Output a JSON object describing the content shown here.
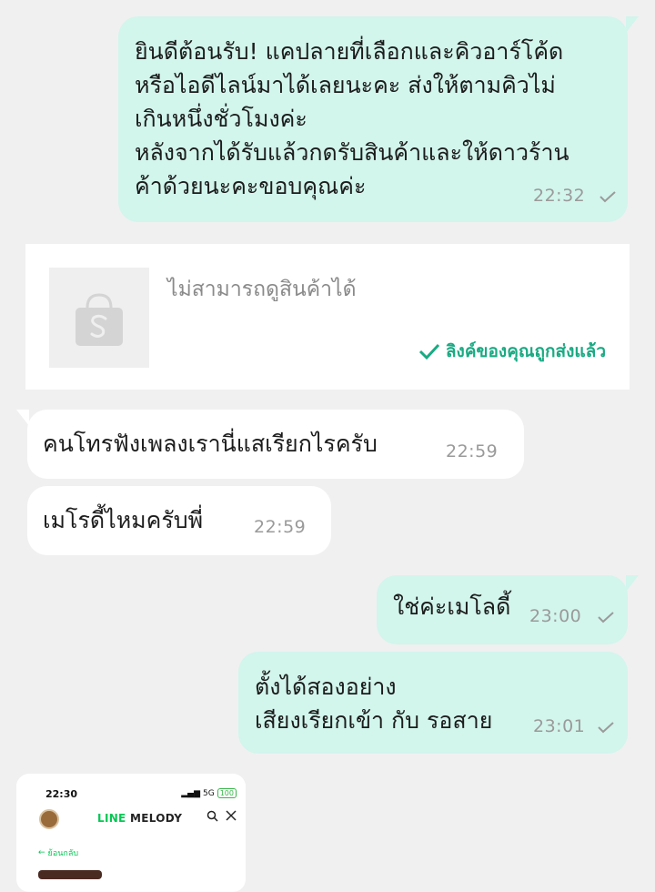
{
  "messages": [
    {
      "direction": "out",
      "text": "ยินดีต้อนรับ! แคปลายที่เลือกและคิวอาร์โค้ด\nหรือไอดีไลน์มาได้เลยนะคะ ส่งให้ตามคิวไม่\nเกินหนึ่งชั่วโมงค่ะ\nหลังจากได้รับแล้วกดรับสินค้าและให้ดาวร้าน\nค้าด้วยนะคะขอบคุณค่ะ",
      "time": "22:32",
      "read": true
    },
    {
      "direction": "in",
      "text": "คนโทรฟังเพลงเรานี่แสเรียกไรครับ",
      "time": "22:59"
    },
    {
      "direction": "in",
      "text": "เมโรดี้ไหมครับพี่",
      "time": "22:59"
    },
    {
      "direction": "out",
      "text": "ใช่ค่ะเมโลดี้",
      "time": "23:00",
      "read": true
    },
    {
      "direction": "out",
      "text": "ตั้งได้สองอย่าง\nเสียงเรียกเข้า กับ รอสาย",
      "time": "23:01",
      "read": true
    }
  ],
  "product_card": {
    "unavailable_text": "ไม่สามารถดูสินค้าได้",
    "status_text": "ลิงค์ของคุณถูกส่งแล้ว",
    "thumb_icon": "shopping-bag-icon"
  },
  "image_preview": {
    "status_time": "22:30",
    "network": "5G",
    "battery": "100",
    "brand_line": "LINE",
    "brand_melody": "MELODY",
    "back_label": "ย้อนกลับ"
  },
  "colors": {
    "background": "#f0f0f0",
    "outgoing_bubble": "#d2f5ec",
    "incoming_bubble": "#ffffff",
    "accent": "#1aaa83",
    "line_green": "#06c755"
  }
}
